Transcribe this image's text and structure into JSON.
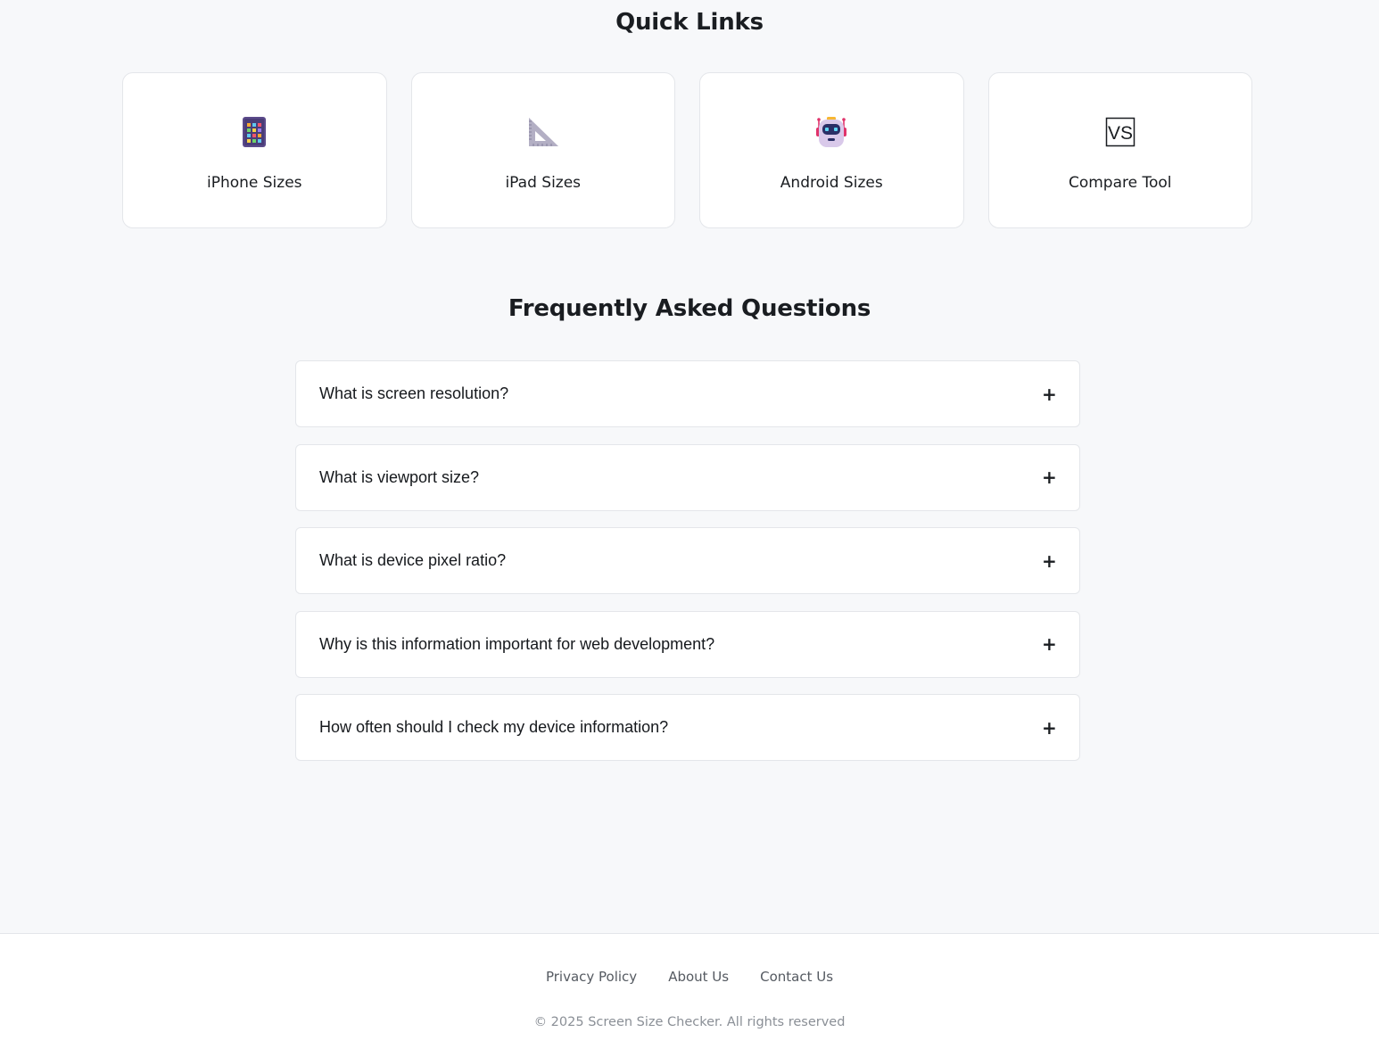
{
  "quick_links": {
    "title": "Quick Links",
    "items": [
      {
        "label": "iPhone Sizes",
        "icon": "phone-apps-icon"
      },
      {
        "label": "iPad Sizes",
        "icon": "triangular-ruler-icon"
      },
      {
        "label": "Android Sizes",
        "icon": "robot-icon"
      },
      {
        "label": "Compare Tool",
        "icon": "vs-icon",
        "icon_text": "VS"
      }
    ]
  },
  "faq": {
    "title": "Frequently Asked Questions",
    "expand_symbol": "+",
    "items": [
      {
        "question": "What is screen resolution?"
      },
      {
        "question": "What is viewport size?"
      },
      {
        "question": "What is device pixel ratio?"
      },
      {
        "question": "Why is this information important for web development?"
      },
      {
        "question": "How often should I check my device information?"
      }
    ]
  },
  "footer": {
    "links": [
      "Privacy Policy",
      "About Us",
      "Contact Us"
    ],
    "copyright": "© 2025 Screen Size Checker. All rights reserved"
  },
  "colors": {
    "page_background": "#f7f8fa",
    "card_background": "#ffffff",
    "border": "#e4e6ea",
    "text_primary": "#1a1d21",
    "text_muted": "#8a8f96"
  }
}
